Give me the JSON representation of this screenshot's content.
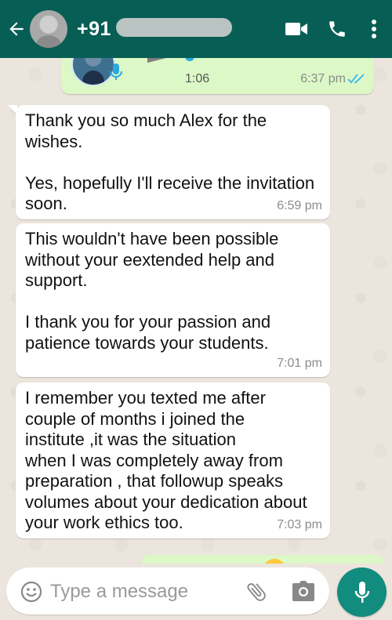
{
  "header": {
    "contact_name": "+91",
    "icons": [
      "back-arrow-icon",
      "video-call-icon",
      "phone-icon",
      "more-vert-icon"
    ]
  },
  "voice_note": {
    "duration": "1:06",
    "time": "6:37 pm",
    "status": "read"
  },
  "messages": [
    {
      "direction": "incoming",
      "text": "Thank you so much Alex for the\nwishes.\n\nYes, hopefully I'll receive the invitation\nsoon.",
      "time": "6:59 pm"
    },
    {
      "direction": "incoming",
      "text": "This wouldn't have been possible\nwithout your eextended help and\nsupport.\n\nI thank you for your passion and\npatience towards your students.",
      "time": "7:01 pm"
    },
    {
      "direction": "incoming",
      "text": "I remember you texted me after\ncouple of months i joined the\ninstitute ,it was the situation\nwhen I was completely away from\npreparation , that followup speaks\nvolumes about your dedication about\nyour work ethics too.",
      "time": "7:03 pm"
    }
  ],
  "input": {
    "placeholder": "Type a message"
  },
  "colors": {
    "header": "#075e54",
    "outgoing_bubble": "#dcf8c6",
    "incoming_bubble": "#ffffff",
    "mic_button": "#128c7e",
    "read_ticks": "#34b7f1"
  }
}
